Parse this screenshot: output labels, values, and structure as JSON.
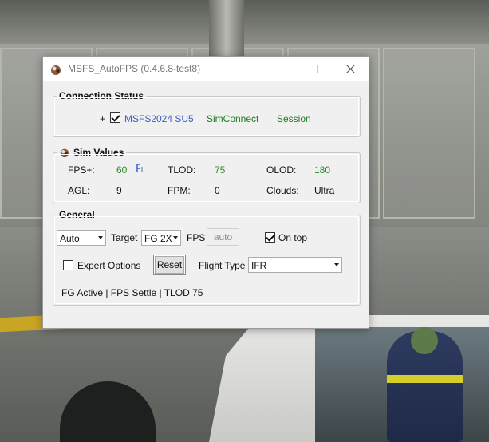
{
  "window": {
    "title": "MSFS_AutoFPS (0.4.6.8-test8)",
    "close_glyph": "✕"
  },
  "connection": {
    "legend": "Connection Status",
    "plus": "+",
    "sim_label": "MSFS2024 SU5",
    "simconnect_label": "SimConnect",
    "session_label": "Session",
    "sim_checked": true
  },
  "sim_values": {
    "legend": "Sim Values",
    "fps_label": "FPS+:",
    "fps_value": "60",
    "tlod_label": "TLOD:",
    "tlod_value": "75",
    "olod_label": "OLOD:",
    "olod_value": "180",
    "agl_label": "AGL:",
    "agl_value": "9",
    "fpm_label": "FPM:",
    "fpm_value": "0",
    "clouds_label": "Clouds:",
    "clouds_value": "Ultra"
  },
  "general": {
    "legend": "General",
    "mode_value": "Auto",
    "target_label": "Target",
    "target_value": "FG 2X",
    "fps_label": "FPS",
    "fps_field": "auto",
    "on_top_label": "On top",
    "on_top_checked": true,
    "expert_label": "Expert Options",
    "expert_checked": false,
    "reset_label": "Reset",
    "flight_type_label": "Flight Type",
    "flight_type_value": "IFR",
    "status_text": "FG Active | FPS Settle | TLOD 75"
  },
  "colors": {
    "blue": "#3a5fc7",
    "green": "#1f7a1f",
    "green_value": "#2e8b2e"
  }
}
